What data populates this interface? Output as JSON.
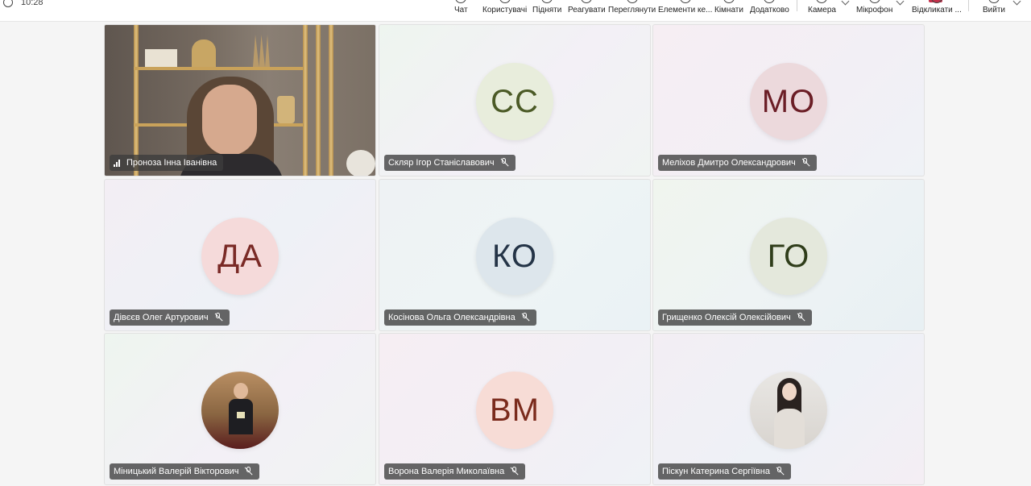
{
  "toolbar": {
    "timer": "10:28",
    "items": [
      {
        "label": "Чат",
        "icon": "chat-icon"
      },
      {
        "label": "Користувачі",
        "icon": "people-icon"
      },
      {
        "label": "Підняти",
        "icon": "raise-hand-icon"
      },
      {
        "label": "Реагувати",
        "icon": "react-icon"
      },
      {
        "label": "Переглянути",
        "icon": "view-icon"
      },
      {
        "label": "Елементи ке...",
        "icon": "apps-icon"
      },
      {
        "label": "Кімнати",
        "icon": "rooms-icon"
      },
      {
        "label": "Додатково",
        "icon": "more-icon"
      },
      {
        "label": "Камера",
        "icon": "camera-icon"
      },
      {
        "label": "Мікрофон",
        "icon": "microphone-icon"
      },
      {
        "label": "Відкликати ...",
        "icon": "share-icon"
      },
      {
        "label": "Вийти",
        "icon": "leave-icon"
      }
    ]
  },
  "participants": [
    {
      "name": "Проноза Інна Іванівна",
      "type": "video"
    },
    {
      "name": "Скляр Ігор Станіславович",
      "initials": "СС",
      "avatar_bg": "#e8eddc",
      "avatar_fg": "#4b5a26"
    },
    {
      "name": "Меліхов Дмитро Олександрович",
      "initials": "МО",
      "avatar_bg": "#ecd9dc",
      "avatar_fg": "#6b1e26"
    },
    {
      "name": "Дівєєв Олег Артурович",
      "initials": "ДА",
      "avatar_bg": "#f5dada",
      "avatar_fg": "#7a2a26"
    },
    {
      "name": "Косінова Ольга Олександрівна",
      "initials": "КО",
      "avatar_bg": "#dde6ec",
      "avatar_fg": "#243447"
    },
    {
      "name": "Грищенко Олексій Олексійович",
      "initials": "ГО",
      "avatar_bg": "#e4e8dc",
      "avatar_fg": "#2f3d1a"
    },
    {
      "name": "Міницький Валерій Вікторович",
      "type": "photo"
    },
    {
      "name": "Ворона Валерія Миколаївна",
      "initials": "ВМ",
      "avatar_bg": "#f7dcd6",
      "avatar_fg": "#7a2a1c"
    },
    {
      "name": "Піскун Катерина Сергіївна",
      "type": "photo"
    }
  ]
}
